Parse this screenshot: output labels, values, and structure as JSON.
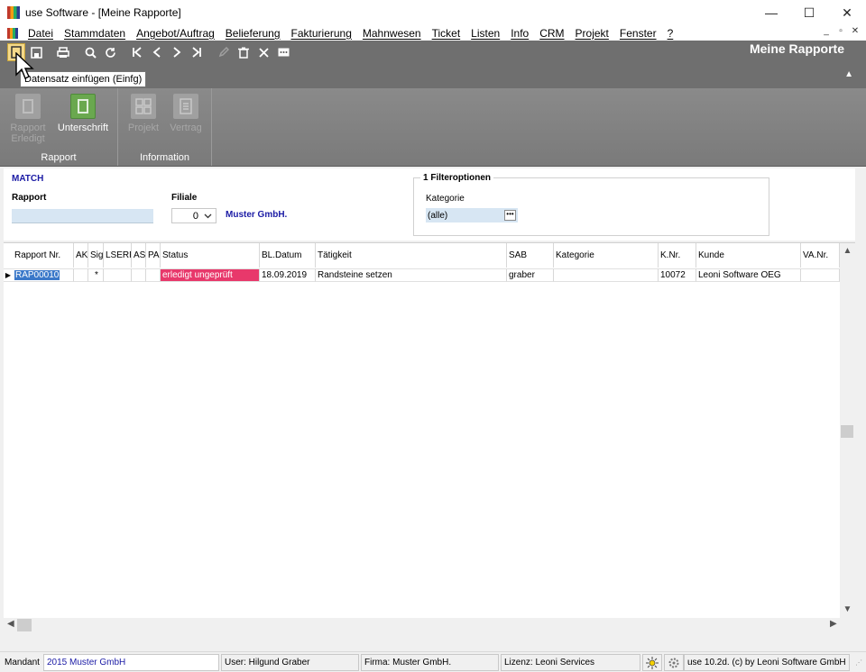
{
  "window": {
    "title": "use Software - [Meine Rapporte]",
    "minimize": "—",
    "maximize": "☐",
    "close": "✕"
  },
  "menu": [
    "Datei",
    "Stammdaten",
    "Angebot/Auftrag",
    "Belieferung",
    "Fakturierung",
    "Mahnwesen",
    "Ticket",
    "Listen",
    "Info",
    "CRM",
    "Projekt",
    "Fenster",
    "?"
  ],
  "mdi_controls": [
    "_",
    "▫",
    "✕"
  ],
  "toolbar": {
    "title": "Meine Rapporte",
    "tooltip": "Datensatz einfügen (Einfg)",
    "icons": [
      "new-record-icon",
      "save-icon",
      "print-icon",
      "search-icon",
      "refresh-icon",
      "first-icon",
      "prev-icon",
      "next-icon",
      "last-icon",
      "edit-icon",
      "delete-icon",
      "cancel-icon",
      "more-icon"
    ]
  },
  "ribbon": {
    "groups": [
      {
        "label": "Rapport",
        "buttons": [
          "Rapport Erledigt",
          "Unterschrift"
        ]
      },
      {
        "label": "Information",
        "buttons": [
          "Projekt",
          "Vertrag"
        ]
      }
    ]
  },
  "filter": {
    "match_label": "MATCH",
    "rapport_label": "Rapport",
    "rapport_value": "",
    "filiale_label": "Filiale",
    "filiale_value": "0",
    "firma": "Muster GmbH.",
    "filteroptionen_title": "1 Filteroptionen",
    "kategorie_label": "Kategorie",
    "kategorie_value": "(alle)"
  },
  "grid": {
    "columns": [
      "Rapport Nr.",
      "AK",
      "Sig",
      "LSERF",
      "AS",
      "PA",
      "Status",
      "BL.Datum",
      "Tätigkeit",
      "SAB",
      "Kategorie",
      "K.Nr.",
      "Kunde",
      "VA.Nr."
    ],
    "rows": [
      {
        "rapport_nr": "RAP00010",
        "ak": "",
        "sig": "*",
        "lserf": "",
        "as": "",
        "pa": "",
        "status": "erledigt ungeprüft",
        "bl_datum": "18.09.2019",
        "taetigkeit": "Randsteine setzen",
        "sab": "graber",
        "kategorie": "",
        "k_nr": "10072",
        "kunde": "Leoni Software OEG",
        "va_nr": ""
      }
    ],
    "status_color": "#e8386b"
  },
  "statusbar": {
    "mandant_label": "Mandant",
    "mandant_value": "2015 Muster GmbH",
    "user": "User: Hilgund Graber",
    "firma": "Firma: Muster GmbH.",
    "lizenz": "Lizenz: Leoni Services",
    "version": "use 10.2d. (c) by Leoni Software GmbH"
  }
}
